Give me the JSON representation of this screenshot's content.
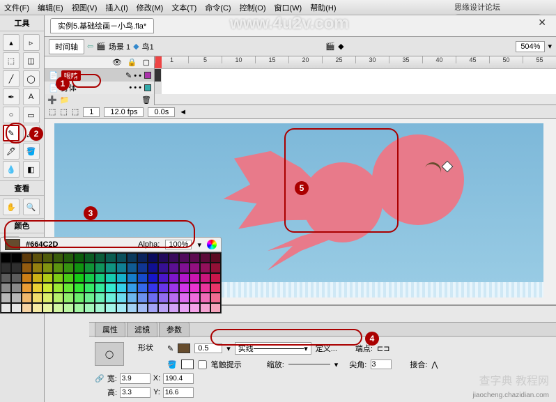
{
  "menubar": {
    "file": "文件(F)",
    "edit": "编辑(E)",
    "view": "视图(V)",
    "insert": "插入(I)",
    "modify": "修改(M)",
    "text": "文本(T)",
    "commands": "命令(C)",
    "control": "控制(O)",
    "window": "窗口(W)",
    "help": "帮助(H)"
  },
  "top_right_text": "思缘设计论坛",
  "watermark1": "www.4u2v.com",
  "doc_tab": "实例5.基础绘画－小鸟.fla*",
  "timeline": {
    "label": "时间轴",
    "scene_label": "场景 1",
    "symbol_label": "鸟1"
  },
  "zoom": "504%",
  "layers": {
    "layer1": "眼睛",
    "layer2": "身体"
  },
  "frame_status": {
    "frame": "1",
    "fps": "12.0 fps",
    "time": "0.0s"
  },
  "ruler": [
    "1",
    "5",
    "10",
    "15",
    "20",
    "25",
    "30",
    "35",
    "40",
    "45",
    "50",
    "55"
  ],
  "toolbox": {
    "title": "工具",
    "view": "查看",
    "color": "颜色"
  },
  "color_panel": {
    "hex": "#664C2D",
    "alpha_label": "Alpha:",
    "alpha_value": "100%"
  },
  "callouts": {
    "n1": "1",
    "n2": "2",
    "n3": "3",
    "n4": "4",
    "n5": "5"
  },
  "props": {
    "tab1": "属性",
    "tab2": "滤镜",
    "tab3": "参数",
    "shape_label": "形状",
    "width_label": "宽:",
    "width_val": "3.9",
    "x_label": "X:",
    "x_val": "190.4",
    "height_label": "高:",
    "height_val": "3.3",
    "y_label": "Y:",
    "y_val": "16.6",
    "stroke_weight": "0.5",
    "stroke_style_label": "实线",
    "custom_label": "定义...",
    "cap_label": "端点:",
    "hinting_label": "笔触提示",
    "scale_label": "缩放:",
    "miter_label": "尖角:",
    "miter_val": "3",
    "join_label": "接合:"
  },
  "bottom_wm1": "查字典 教程网",
  "bottom_wm2": "jiaocheng.chazidian.com"
}
